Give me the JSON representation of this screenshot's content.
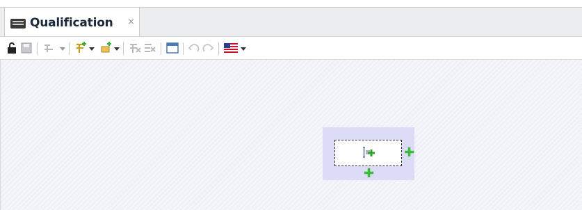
{
  "tab": {
    "title": "Qualification",
    "close": "⨯"
  },
  "toolbar": {
    "buttons": [
      "lock",
      "save",
      "connection",
      "add-connection-dropdown",
      "add-node-dropdown",
      "delete-connection",
      "delete-node",
      "window",
      "undo",
      "redo",
      "language-flag"
    ]
  },
  "canvas": {
    "node": {
      "label": ""
    },
    "selection_color": "#dcdcf6",
    "plus_color": "#3dbb3d"
  }
}
